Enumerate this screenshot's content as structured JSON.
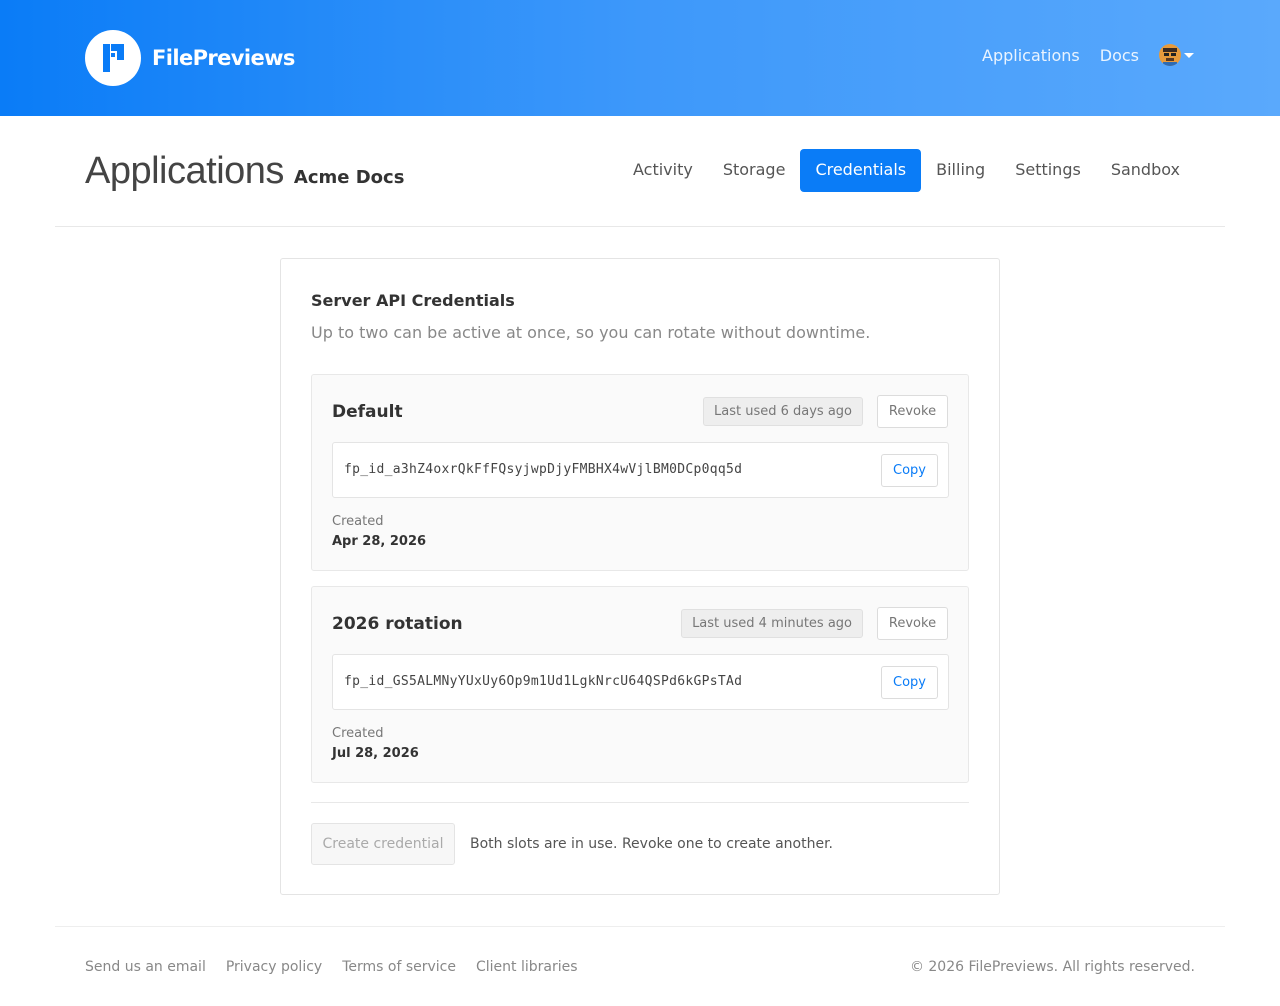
{
  "brand": {
    "name": "FilePreviews"
  },
  "topnav": {
    "applications": "Applications",
    "docs": "Docs"
  },
  "page": {
    "title": "Applications",
    "app_name": "Acme Docs"
  },
  "subnav": [
    "Activity",
    "Storage",
    "Credentials",
    "Billing",
    "Settings",
    "Sandbox"
  ],
  "active_tab": "Credentials",
  "card": {
    "title": "Server API Credentials",
    "subtitle": "Up to two can be active at once, so you can rotate without downtime."
  },
  "credentials": [
    {
      "name": "Default",
      "last_used": "Last used 6 days ago",
      "revoke_label": "Revoke",
      "key": "fp_id_a3hZ4oxrQkFfFQsyjwpDjyFMBHX4wVjlBM0DCp0qq5d",
      "copy_label": "Copy",
      "created_label": "Created",
      "created_date": "Apr 28, 2026"
    },
    {
      "name": "2026 rotation",
      "last_used": "Last used 4 minutes ago",
      "revoke_label": "Revoke",
      "key": "fp_id_GS5ALMNyYUxUy6Op9m1Ud1LgkNrcU64QSPd6kGPsTAd",
      "copy_label": "Copy",
      "created_label": "Created",
      "created_date": "Jul 28, 2026"
    }
  ],
  "actions": {
    "create_label": "Create credential",
    "create_note": "Both slots are in use. Revoke one to create another."
  },
  "footer": {
    "links": [
      "Send us an email",
      "Privacy policy",
      "Terms of service",
      "Client libraries"
    ],
    "copyright": "© 2026 FilePreviews. All rights reserved."
  },
  "colors": {
    "primary": "#0a7cf7",
    "header_gradient_end": "#5aa9fc"
  }
}
